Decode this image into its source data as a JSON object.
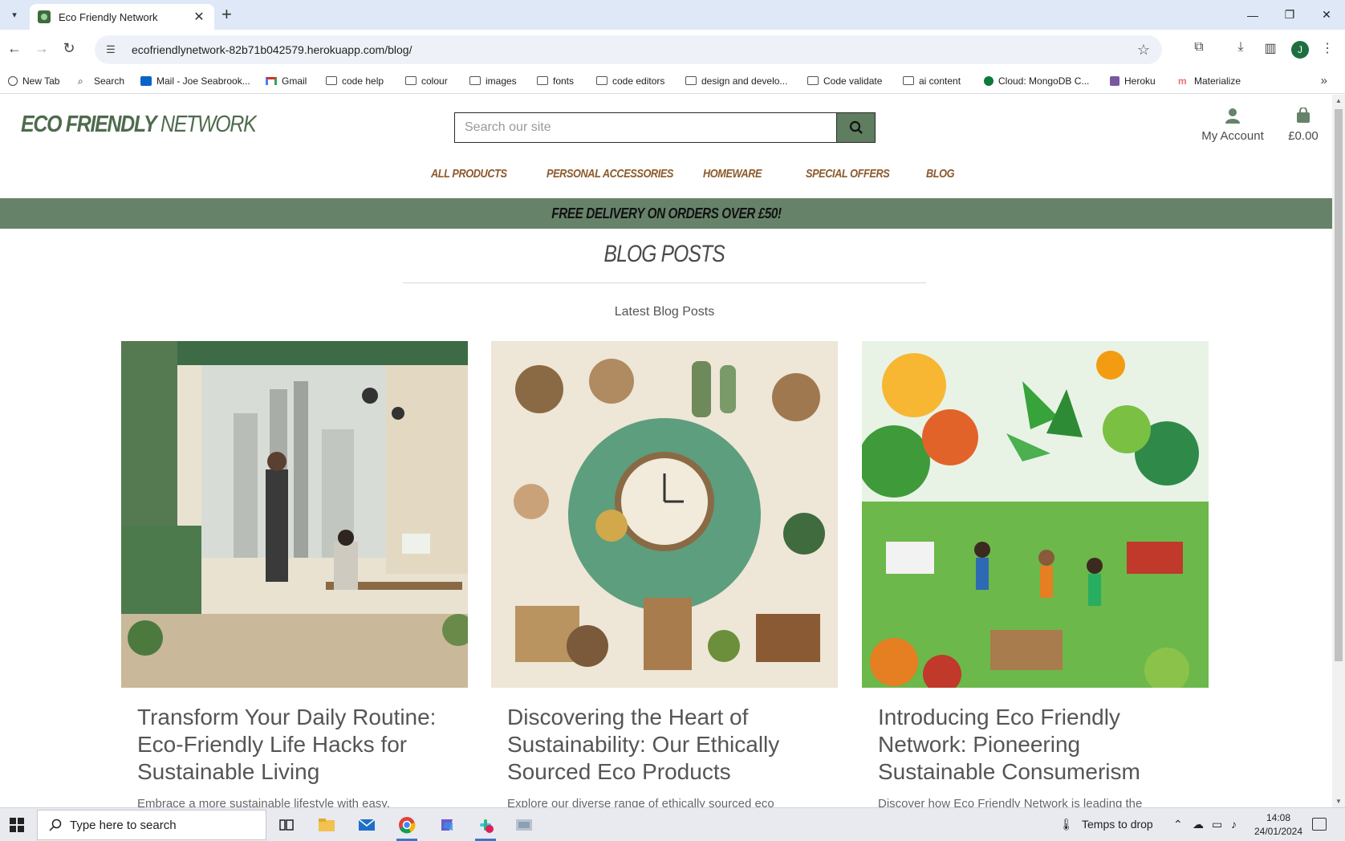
{
  "browser": {
    "tab_title": "Eco Friendly Network",
    "url": "ecofriendlynetwork-82b71b042579.herokuapp.com/blog/",
    "profile_initial": "J"
  },
  "bookmarks": [
    {
      "label": "New Tab",
      "icon": "globe-icon"
    },
    {
      "label": "Search",
      "icon": "search-icon"
    },
    {
      "label": "Mail - Joe Seabrook...",
      "icon": "outlook-icon"
    },
    {
      "label": "Gmail",
      "icon": "gmail-icon"
    },
    {
      "label": "code help",
      "icon": "folder-icon"
    },
    {
      "label": "colour",
      "icon": "folder-icon"
    },
    {
      "label": "images",
      "icon": "folder-icon"
    },
    {
      "label": "fonts",
      "icon": "folder-icon"
    },
    {
      "label": "code editors",
      "icon": "folder-icon"
    },
    {
      "label": "design and develo...",
      "icon": "folder-icon"
    },
    {
      "label": "Code validate",
      "icon": "folder-icon"
    },
    {
      "label": "ai content",
      "icon": "folder-icon"
    },
    {
      "label": "Cloud: MongoDB C...",
      "icon": "mongodb-icon"
    },
    {
      "label": "Heroku",
      "icon": "heroku-icon"
    },
    {
      "label": "Materialize",
      "icon": "materialize-icon"
    }
  ],
  "site": {
    "logo_bold": "ECO FRIENDLY",
    "logo_light": " NETWORK",
    "search_placeholder": "Search our site",
    "account_label": "My Account",
    "bag_total": "£0.00",
    "nav": [
      "ALL PRODUCTS",
      "PERSONAL ACCESSORIES",
      "HOMEWARE",
      "SPECIAL OFFERS",
      "BLOG"
    ],
    "banner": "FREE DELIVERY ON ORDERS OVER £50!",
    "accent_color": "#66836a",
    "nav_color": "#8a5a2b"
  },
  "blog": {
    "title": "BLOG POSTS",
    "subtitle": "Latest Blog Posts",
    "posts": [
      {
        "title": "Transform Your Daily Routine: Eco-Friendly Life Hacks for Sustainable Living",
        "excerpt": "Embrace a more sustainable lifestyle with easy,"
      },
      {
        "title": "Discovering the Heart of Sustainability: Our Ethically Sourced Eco Products",
        "excerpt": "Explore our diverse range of ethically sourced eco"
      },
      {
        "title": "Introducing Eco Friendly Network: Pioneering Sustainable Consumerism",
        "excerpt": "Discover how Eco Friendly Network is leading the"
      }
    ]
  },
  "taskbar": {
    "search_placeholder": "Type here to search",
    "weather": "Temps to drop",
    "time": "14:08",
    "date": "24/01/2024"
  }
}
